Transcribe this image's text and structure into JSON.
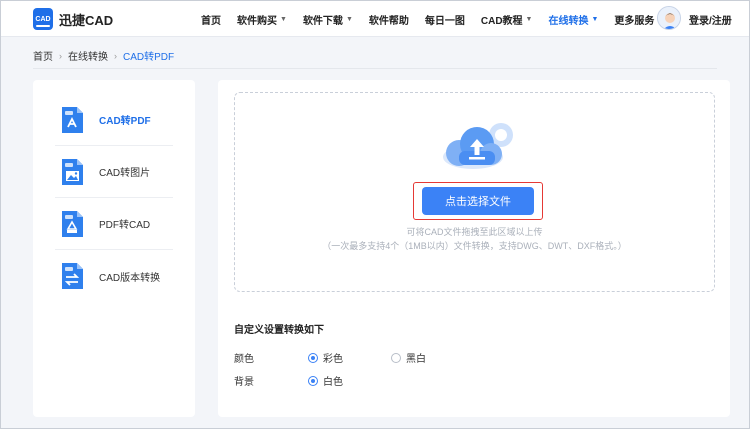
{
  "header": {
    "logo_badge": "CAD",
    "logo_text": "迅捷CAD",
    "nav": [
      {
        "label": "首页",
        "has_dropdown": false,
        "active": false
      },
      {
        "label": "软件购买",
        "has_dropdown": true,
        "active": false
      },
      {
        "label": "软件下载",
        "has_dropdown": true,
        "active": false
      },
      {
        "label": "软件帮助",
        "has_dropdown": false,
        "active": false
      },
      {
        "label": "每日一图",
        "has_dropdown": false,
        "active": false
      },
      {
        "label": "CAD教程",
        "has_dropdown": true,
        "active": false
      },
      {
        "label": "在线转换",
        "has_dropdown": true,
        "active": true
      },
      {
        "label": "更多服务",
        "has_dropdown": true,
        "active": false
      }
    ],
    "login_label": "登录/注册"
  },
  "breadcrumb": {
    "items": [
      "首页",
      "在线转换",
      "CAD转PDF"
    ]
  },
  "sidebar": {
    "items": [
      {
        "label": "CAD转PDF",
        "active": true,
        "icon": "cad-to-pdf-icon"
      },
      {
        "label": "CAD转图片",
        "active": false,
        "icon": "cad-to-image-icon"
      },
      {
        "label": "PDF转CAD",
        "active": false,
        "icon": "pdf-to-cad-icon"
      },
      {
        "label": "CAD版本转换",
        "active": false,
        "icon": "cad-version-convert-icon"
      }
    ]
  },
  "upload": {
    "button_label": "点击选择文件",
    "hint_line1": "可将CAD文件拖拽至此区域以上传",
    "hint_line2": "（一次最多支持4个（1MB以内）文件转换，支持DWG、DWT、DXF格式。）"
  },
  "settings": {
    "title": "自定义设置转换如下",
    "color": {
      "label": "颜色",
      "options": [
        {
          "label": "彩色",
          "checked": true
        },
        {
          "label": "黑白",
          "checked": false
        }
      ]
    },
    "background": {
      "label": "背景",
      "options": [
        {
          "label": "白色",
          "checked": true
        }
      ]
    }
  },
  "colors": {
    "accent": "#1f6fe8",
    "button": "#3b82f6",
    "highlight_frame": "#e53935"
  }
}
